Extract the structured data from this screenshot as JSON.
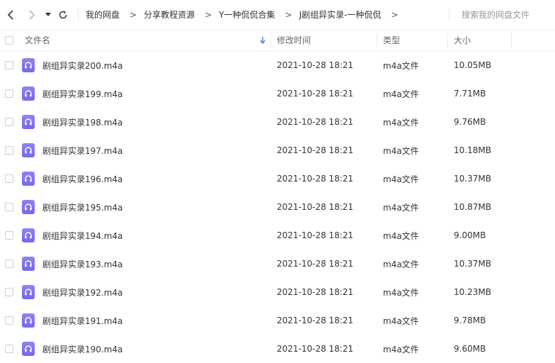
{
  "nav": {
    "back_icon": "chevron-left-icon",
    "forward_icon": "chevron-right-icon",
    "history_icon": "caret-down-icon",
    "refresh_icon": "refresh-icon"
  },
  "breadcrumb": [
    "我的网盘",
    "分享教程资源",
    "Y一种侃侃合集",
    "J剧组异实录-一种侃侃"
  ],
  "search": {
    "placeholder": "搜索我的网盘文件"
  },
  "columns": {
    "name": "文件名",
    "modified": "修改时间",
    "type": "类型",
    "size": "大小"
  },
  "files": [
    {
      "name": "剧组异实录200.m4a",
      "modified": "2021-10-28 18:21",
      "type": "m4a文件",
      "size": "10.05MB"
    },
    {
      "name": "剧组异实录199.m4a",
      "modified": "2021-10-28 18:21",
      "type": "m4a文件",
      "size": "7.71MB"
    },
    {
      "name": "剧组异实录198.m4a",
      "modified": "2021-10-28 18:21",
      "type": "m4a文件",
      "size": "9.76MB"
    },
    {
      "name": "剧组异实录197.m4a",
      "modified": "2021-10-28 18:21",
      "type": "m4a文件",
      "size": "10.18MB"
    },
    {
      "name": "剧组异实录196.m4a",
      "modified": "2021-10-28 18:21",
      "type": "m4a文件",
      "size": "10.37MB"
    },
    {
      "name": "剧组异实录195.m4a",
      "modified": "2021-10-28 18:21",
      "type": "m4a文件",
      "size": "10.87MB"
    },
    {
      "name": "剧组异实录194.m4a",
      "modified": "2021-10-28 18:21",
      "type": "m4a文件",
      "size": "9.00MB"
    },
    {
      "name": "剧组异实录193.m4a",
      "modified": "2021-10-28 18:21",
      "type": "m4a文件",
      "size": "10.37MB"
    },
    {
      "name": "剧组异实录192.m4a",
      "modified": "2021-10-28 18:21",
      "type": "m4a文件",
      "size": "10.23MB"
    },
    {
      "name": "剧组异实录191.m4a",
      "modified": "2021-10-28 18:21",
      "type": "m4a文件",
      "size": "9.78MB"
    },
    {
      "name": "剧组异实录190.m4a",
      "modified": "2021-10-28 18:21",
      "type": "m4a文件",
      "size": "9.60MB"
    }
  ],
  "colors": {
    "file_icon": "#7b6ff0",
    "sort_accent": "#4a90e2"
  }
}
